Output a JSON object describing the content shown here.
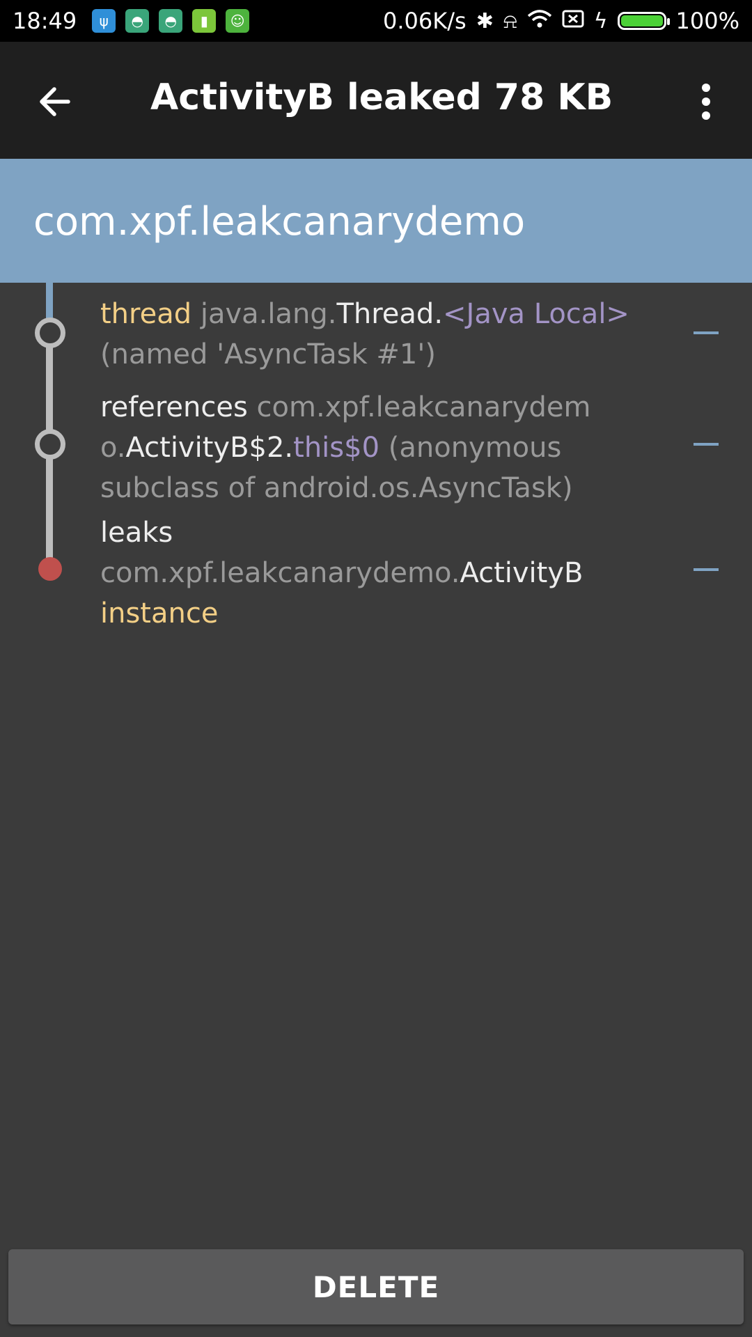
{
  "status_bar": {
    "time": "18:49",
    "net_speed": "0.06K/s",
    "battery_level": "100%",
    "app_icons": [
      "usb-icon",
      "android-icon",
      "android-icon",
      "battery-app-icon",
      "android-face-icon"
    ],
    "status_icons": [
      "bluetooth-icon",
      "mute-icon",
      "wifi-icon",
      "no-sim-icon",
      "charging-icon",
      "battery-icon"
    ]
  },
  "toolbar": {
    "title": "ActivityB leaked 78 KB",
    "back_icon": "arrow-back-icon",
    "menu_icon": "more-vert-icon"
  },
  "header": {
    "package": "com.xpf.leakcanarydemo"
  },
  "trace": {
    "rows": [
      {
        "parts": [
          {
            "text": "thread",
            "color": "#f3cf86"
          },
          {
            "text": " java.lang.",
            "color": "#9a9a9a"
          },
          {
            "text": "Thread.",
            "color": "#eeeeee"
          },
          {
            "text": "<Java Local>",
            "color": "#a394c6"
          },
          {
            "text": " (named 'AsyncTask #1')",
            "color": "#9a9a9a"
          }
        ]
      },
      {
        "parts": [
          {
            "text": "references",
            "color": "#eeeeee"
          },
          {
            "text": " com.xpf.leakcanarydem o.",
            "color": "#9a9a9a"
          },
          {
            "text": "ActivityB$2.",
            "color": "#eeeeee"
          },
          {
            "text": "this$0",
            "color": "#a394c6"
          },
          {
            "text": " (anonymous subclass of android.os.AsyncTask)",
            "color": "#9a9a9a"
          }
        ]
      },
      {
        "parts": [
          {
            "text": "leaks",
            "color": "#eeeeee"
          },
          {
            "text": " com.xpf.leakcanarydemo.",
            "color": "#9a9a9a"
          },
          {
            "text": "ActivityB",
            "color": "#eeeeee"
          },
          {
            "text": " instance",
            "color": "#f3cf86"
          }
        ]
      }
    ],
    "leak_color": "#c0504d"
  },
  "actions": {
    "delete_label": "DELETE"
  }
}
